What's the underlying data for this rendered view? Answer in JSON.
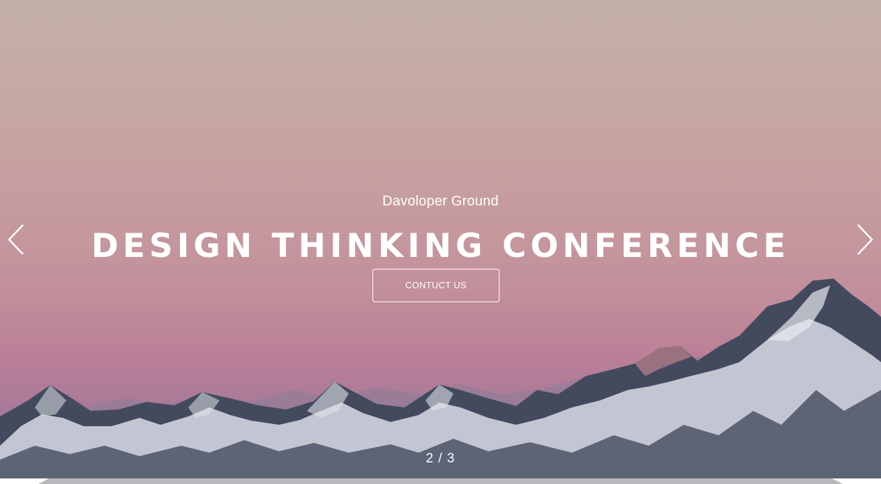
{
  "hero": {
    "subtitle": "Davoloper Ground",
    "title": "DESIGN THINKING CONFERENCE",
    "cta_label": "CONTUCT US"
  },
  "slider": {
    "counter": "2 / 3",
    "current": 2,
    "total": 3,
    "prev_icon": "chevron-left-icon",
    "next_icon": "chevron-right-icon"
  },
  "colors": {
    "sky_top": "#c4afa9",
    "sky_bottom": "#ba7f98",
    "mountain_dark": "#3d4255",
    "snow": "#c9ccd6",
    "text": "#ffffff"
  }
}
